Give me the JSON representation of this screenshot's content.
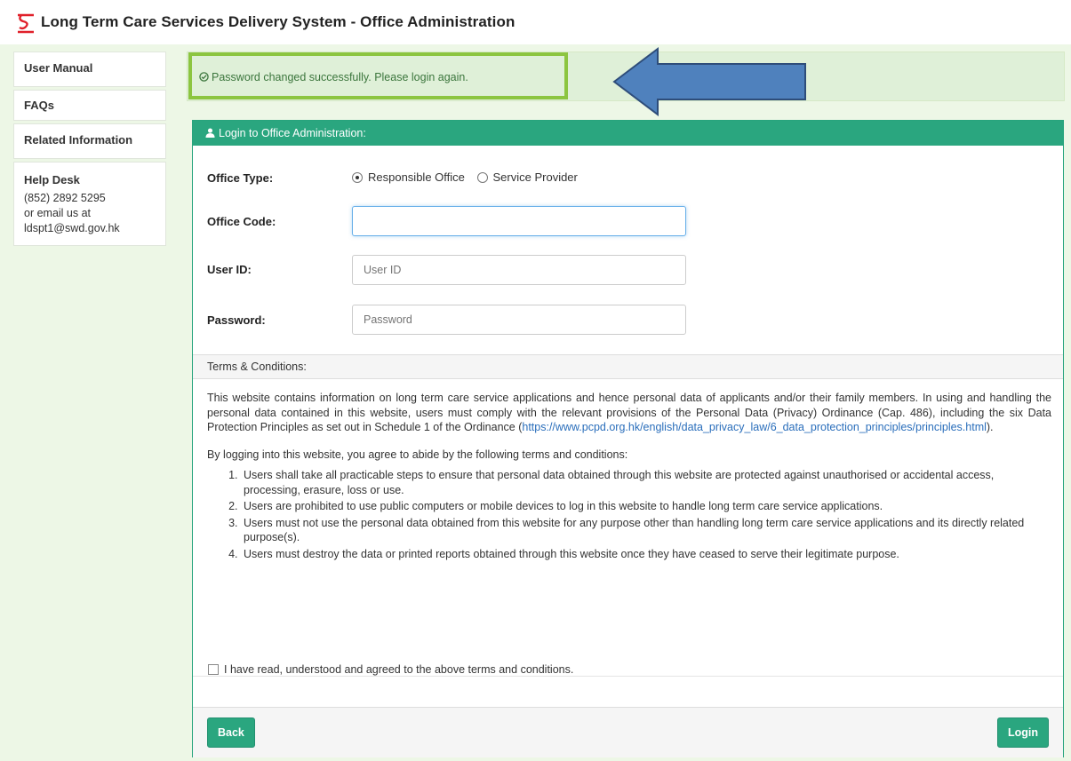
{
  "header": {
    "title": "Long Term Care Services Delivery System - Office Administration",
    "logo_color": "#e0202a"
  },
  "sidebar": {
    "items": [
      {
        "label": "User Manual"
      },
      {
        "label": "FAQs"
      },
      {
        "label": "Related Information"
      }
    ],
    "helpdesk": {
      "title": "Help Desk",
      "phone": "(852) 2892 5295",
      "email_prefix": "or email us at",
      "email": "ldspt1@swd.gov.hk"
    }
  },
  "alert": {
    "message": "Password changed successfully. Please login again."
  },
  "login_panel": {
    "title": "Login to Office Administration:",
    "office_type_label": "Office Type:",
    "office_type_options": [
      "Responsible Office",
      "Service Provider"
    ],
    "office_type_selected": "Responsible Office",
    "office_code_label": "Office Code:",
    "office_code_value": "",
    "user_id_label": "User ID:",
    "user_id_placeholder": "User ID",
    "password_label": "Password:",
    "password_placeholder": "Password"
  },
  "terms": {
    "heading": "Terms & Conditions:",
    "intro_text": "This website contains information on long term care service applications and hence personal data of applicants and/or their family members. In using and handling the personal data contained in this website, users must comply with the relevant provisions of the Personal Data (Privacy) Ordinance (Cap. 486), including the six Data Protection Principles as set out in Schedule 1 of the Ordinance",
    "link_text": "https://www.pcpd.org.hk/english/data_privacy_law/6_data_protection_principles/principles.html",
    "lead_in": "By logging into this website, you agree to abide by the following terms and conditions:",
    "items": [
      "Users shall take all practicable steps to ensure that personal data obtained through this website are protected against unauthorised or accidental access, processing, erasure, loss or use.",
      "Users are prohibited to use public computers or mobile devices to log in this website to handle long term care service applications.",
      "Users must not use the personal data obtained from this website for any purpose other than handling long term care service applications and its directly related purpose(s).",
      "Users must destroy the data or printed reports obtained through this website once they have ceased to serve their legitimate purpose."
    ],
    "agree_label": "I have read, understood and agreed to the above terms and conditions.",
    "agree_checked": false
  },
  "buttons": {
    "back": "Back",
    "login": "Login"
  },
  "colors": {
    "accent": "#2aa67f",
    "alert_bg": "#dff0d8",
    "alert_text": "#3c763d",
    "highlight": "#8cc540",
    "arrow": "#4f81bd",
    "page_bg": "#edf7e6"
  }
}
